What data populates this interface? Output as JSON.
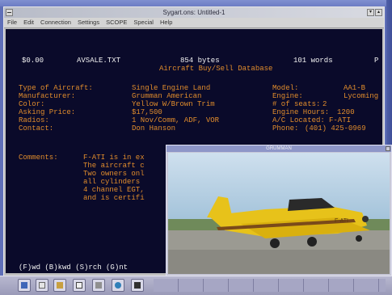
{
  "window": {
    "title": "Sygart.ons: Untitled-1"
  },
  "menu": [
    "File",
    "Edit",
    "Connection",
    "Settings",
    "SCOPE",
    "Special",
    "Help"
  ],
  "terminal": {
    "header": {
      "price": "$0.00",
      "filename": "AVSALE.TXT",
      "bytes": "854 bytes",
      "words": "101 words",
      "marker": "P",
      "subtitle": "Aircraft Buy/Sell Database"
    },
    "fields_left": [
      {
        "label": "Type of Aircraft:",
        "value": "Single Engine Land"
      },
      {
        "label": "Manufacturer:",
        "value": "Grumman American"
      },
      {
        "label": "Color:",
        "value": "Yellow W/Brown Trim"
      },
      {
        "label": "Asking Price:",
        "value": "$17,500"
      },
      {
        "label": "Radios:",
        "value": "1 Nov/Comm, ADF, VOR"
      },
      {
        "label": "Contact:",
        "value": "Don Hanson"
      }
    ],
    "fields_right": [
      {
        "label": "Model:",
        "value": "AA1-B"
      },
      {
        "label": "Engine:",
        "value": "Lycoming"
      },
      {
        "label": "# of seats:",
        "value": "2"
      },
      {
        "label": "Engine Hours:",
        "value": "1200"
      },
      {
        "label": "A/C Located:",
        "value": "F-ATI"
      },
      {
        "label": "Phone:",
        "value": "(401) 425-0969"
      }
    ],
    "comments_label": "Comments:",
    "comments_lines": [
      "F-ATI is in ex",
      "The aircraft c",
      "Two owners onl",
      "all cylinders",
      "4 channel EGT,",
      "and is certifi"
    ],
    "status_line": "(F)wd (B)kwd (S)rch (G)nt"
  },
  "photo_viewer": {
    "title": "GRUMMAN"
  },
  "taskbar": {
    "icons": [
      "program-manager-icon",
      "chat-icon",
      "home-icon",
      "document-icon",
      "tools-icon",
      "globe-icon",
      "phone-icon"
    ]
  },
  "colors": {
    "terminal_bg": "#0a0a2a",
    "label_orange": "#e08c2c",
    "text_white": "#f2f2f2",
    "aircraft_yellow": "#e7c21a"
  }
}
